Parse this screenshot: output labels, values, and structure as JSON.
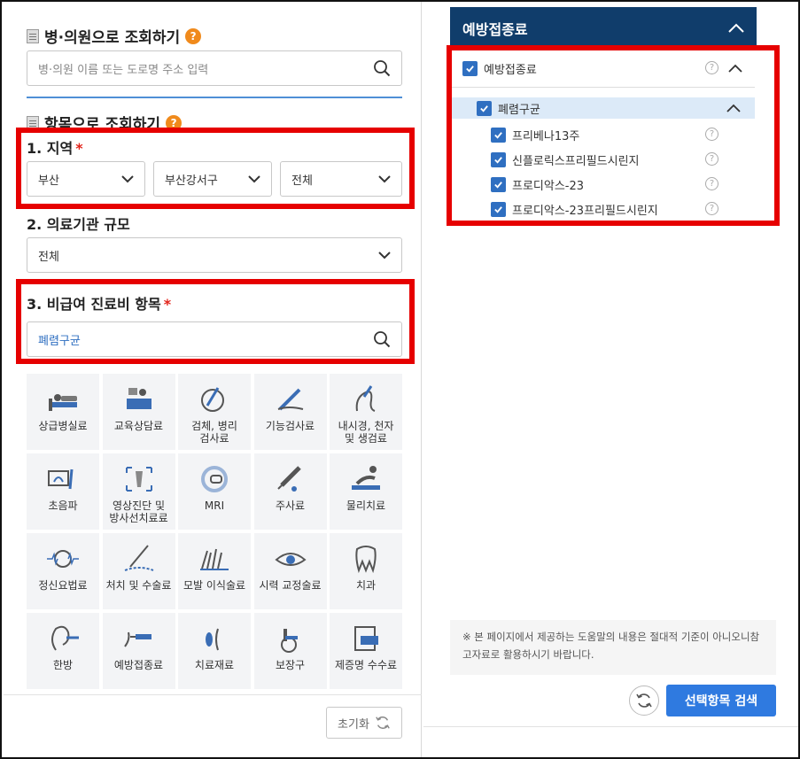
{
  "hospital_search": {
    "title": "병·의원으로 조회하기",
    "help": "?",
    "placeholder": "병·의원 이름 또는 도로명 주소 입력"
  },
  "item_search": {
    "title": "항목으로 조회하기",
    "help": "?"
  },
  "region": {
    "label": "1. 지역",
    "required": "*",
    "sido": "부산",
    "sigungu": "부산강서구",
    "dong": "전체"
  },
  "scale": {
    "label": "2. 의료기관 규모",
    "value": "전체"
  },
  "category": {
    "label": "3. 비급여 진료비 항목",
    "required": "*",
    "value": "폐렴구균"
  },
  "tiles": [
    {
      "label": "상급병실료",
      "icon": "hospital-bed-icon"
    },
    {
      "label": "교육상담료",
      "icon": "counseling-icon"
    },
    {
      "label": "검체, 병리\n검사료",
      "icon": "specimen-icon"
    },
    {
      "label": "기능검사료",
      "icon": "function-test-icon"
    },
    {
      "label": "내시경, 천자\n및 생검료",
      "icon": "endoscope-icon"
    },
    {
      "label": "초음파",
      "icon": "ultrasound-icon"
    },
    {
      "label": "영상진단 및\n방사선치료료",
      "icon": "radiology-icon"
    },
    {
      "label": "MRI",
      "icon": "mri-icon"
    },
    {
      "label": "주사료",
      "icon": "syringe-icon"
    },
    {
      "label": "물리치료",
      "icon": "physio-icon"
    },
    {
      "label": "정신요법료",
      "icon": "psychotherapy-icon"
    },
    {
      "label": "처치 및 수술료",
      "icon": "surgery-icon"
    },
    {
      "label": "모발 이식술료",
      "icon": "hair-transplant-icon"
    },
    {
      "label": "시력 교정술료",
      "icon": "eye-icon"
    },
    {
      "label": "치과",
      "icon": "tooth-icon"
    },
    {
      "label": "한방",
      "icon": "acupuncture-icon"
    },
    {
      "label": "예방접종료",
      "icon": "vaccine-icon"
    },
    {
      "label": "치료재료",
      "icon": "material-icon"
    },
    {
      "label": "보장구",
      "icon": "wheelchair-icon"
    },
    {
      "label": "제증명 수수료",
      "icon": "certificate-icon"
    }
  ],
  "reset_label": "초기화",
  "right_panel": {
    "header": "예방접종료",
    "tree_root": "예방접종료",
    "group": "폐렴구균",
    "items": [
      "프리베나13주",
      "신플로릭스프리필드시린지",
      "프로디악스-23",
      "프로디악스-23프리필드시린지"
    ]
  },
  "notice": "※ 본 페이지에서 제공하는 도움말의 내용은 절대적 기준이 아니오니참고자료로 활용하시기 바랍니다.",
  "search_button": "선택항목 검색",
  "colors": {
    "accent": "#2f7ae0",
    "header": "#103d6b",
    "highlight": "#e60000",
    "badge": "#f08a1c"
  }
}
